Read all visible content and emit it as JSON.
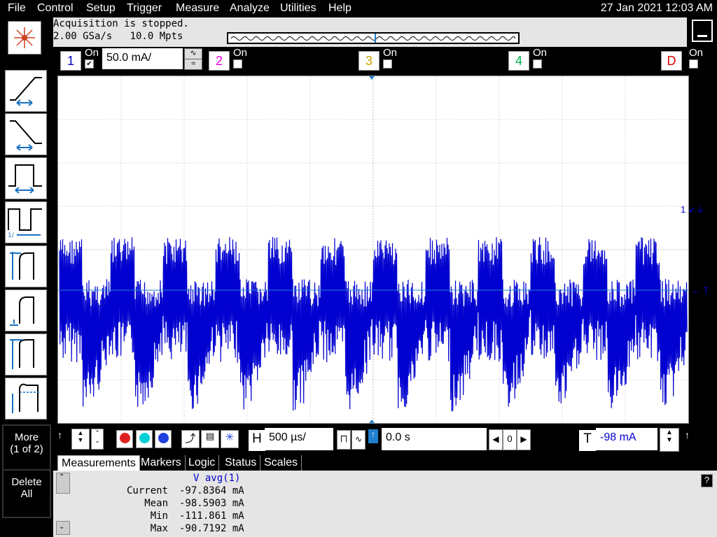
{
  "menu": [
    "File",
    "Control",
    "Setup",
    "Trigger",
    "Measure",
    "Analyze",
    "Utilities",
    "Help"
  ],
  "datetime": "27 Jan 2021 12:03 AM",
  "acquisition": {
    "status": "Acquisition is stopped.",
    "rate": "2.00 GSa/s   10.0 Mpts"
  },
  "channels": {
    "ch1": {
      "label": "1",
      "on": "On",
      "scale": "50.0 mA/",
      "color": "#0000c8"
    },
    "ch2": {
      "label": "2",
      "on": "On",
      "color": "#e000e0"
    },
    "ch3": {
      "label": "3",
      "on": "On",
      "color": "#c8a000"
    },
    "ch4": {
      "label": "4",
      "on": "On",
      "color": "#00b050"
    },
    "chD": {
      "label": "D",
      "on": "On",
      "color": "#e00000"
    }
  },
  "side_buttons": {
    "more": "More\n(1 of 2)",
    "delete_all": "Delete\nAll"
  },
  "right_markers": {
    "ch1": "1",
    "trigger": "T"
  },
  "controls": {
    "horizontal_letter": "H",
    "horizontal_scale": "500 µs/",
    "delay": "0.0 s",
    "zoom_value": "0",
    "trigger_letter": "T",
    "trigger_level": "-98 mA"
  },
  "tabs": [
    "Measurements",
    "Markers",
    "Logic",
    "Status",
    "Scales"
  ],
  "measurement": {
    "title": "V avg(1)",
    "rows": [
      {
        "label": "Current",
        "value": "-97.8364  mA"
      },
      {
        "label": "Mean",
        "value": "-98.5903  mA"
      },
      {
        "label": "Min",
        "value": "-111.861  mA"
      },
      {
        "label": "Max",
        "value": "-90.7192  mA"
      }
    ]
  },
  "waveform_color": "#0000d0",
  "icons": [
    "keysight-logo-icon",
    "rising-edge-icon",
    "falling-edge-icon",
    "pulse-width-icon",
    "period-icon",
    "rise-time-icon",
    "amplitude-icon",
    "top-icon",
    "overshoot-icon"
  ]
}
